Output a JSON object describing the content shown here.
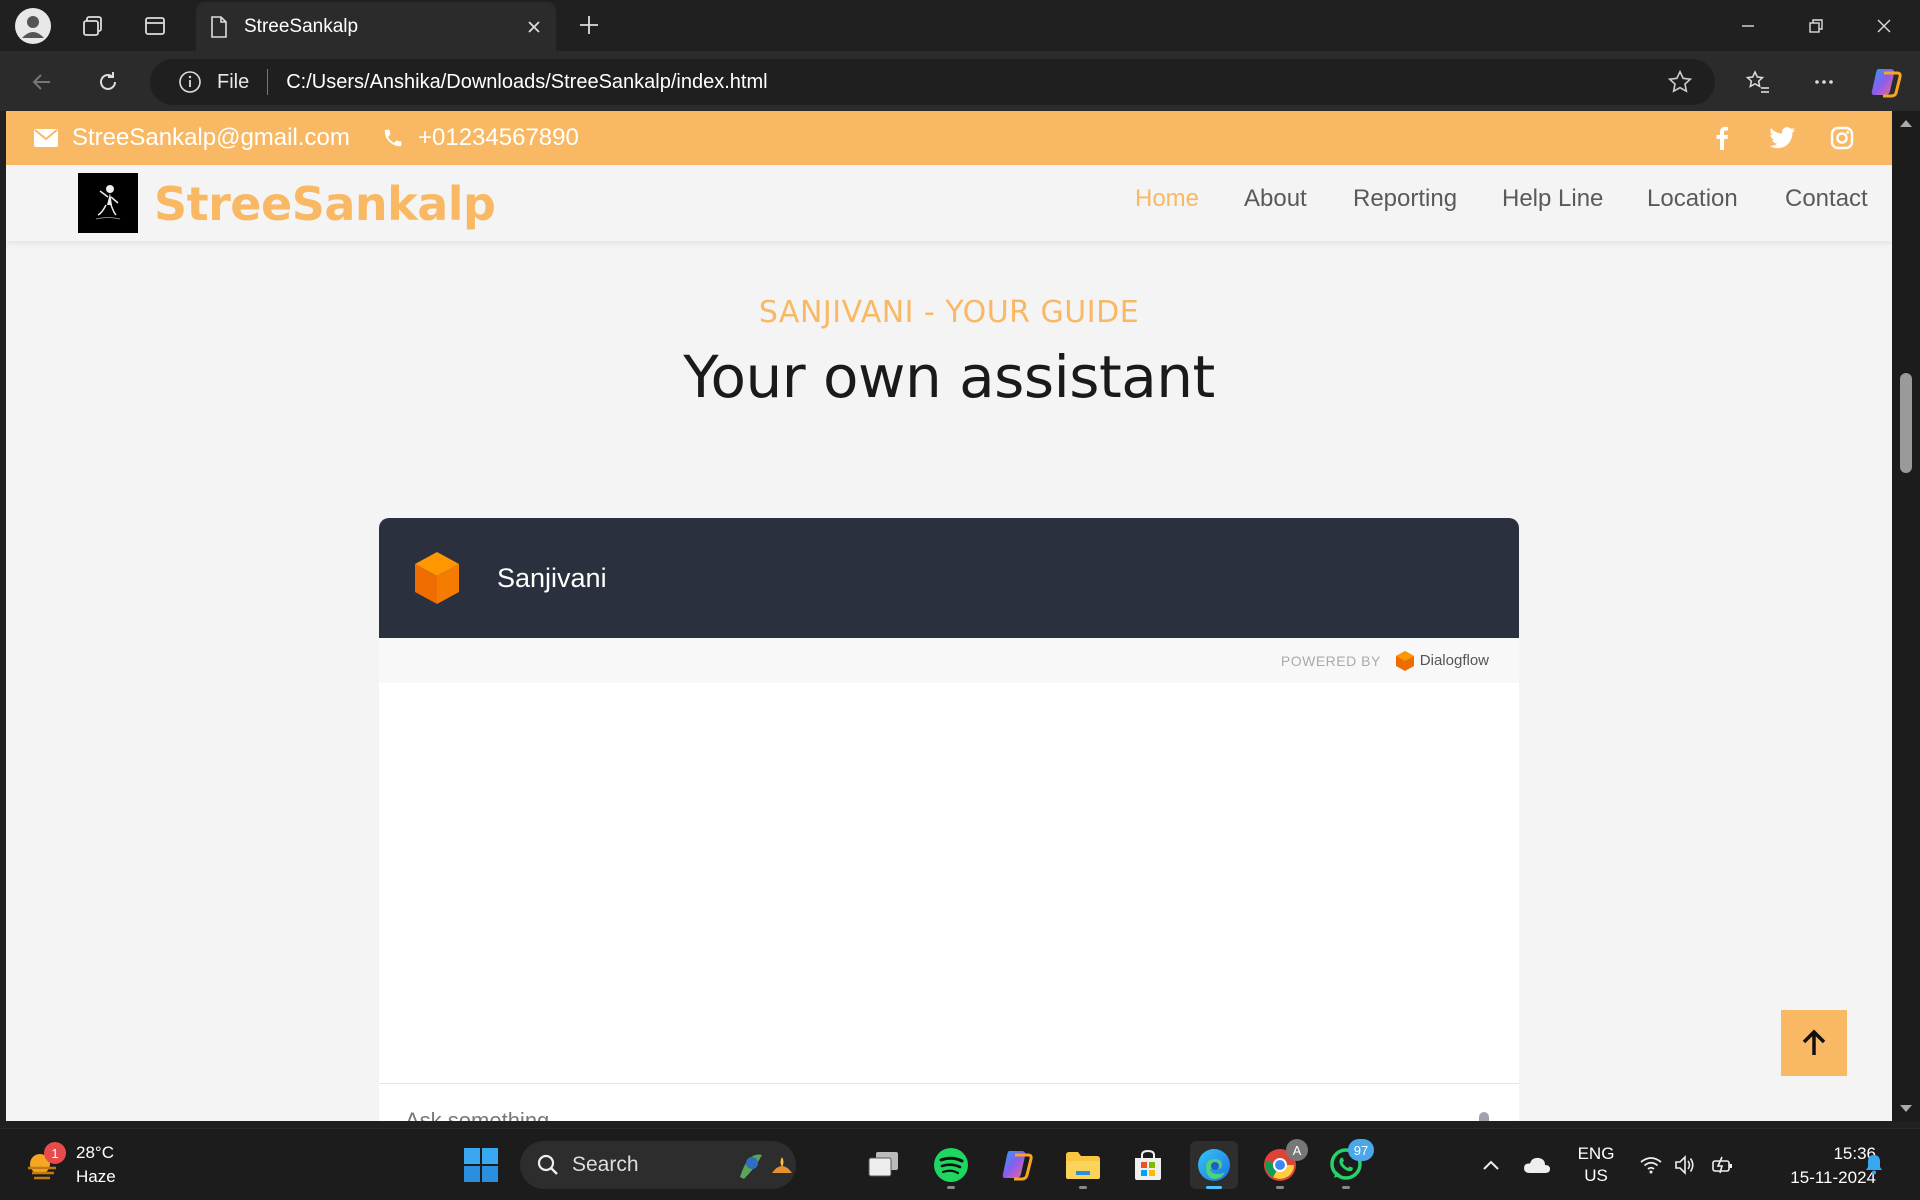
{
  "browser": {
    "tab_title": "StreeSankalp",
    "address_prefix": "File",
    "url": "C:/Users/Anshika/Downloads/StreeSankalp/index.html"
  },
  "site": {
    "email": "StreeSankalp@gmail.com",
    "phone": "+01234567890",
    "brand": "StreeSankalp",
    "accent_color": "#f9b964",
    "nav": [
      {
        "label": "Home",
        "active": true
      },
      {
        "label": "About",
        "active": false
      },
      {
        "label": "Reporting",
        "active": false
      },
      {
        "label": "Help Line",
        "active": false
      },
      {
        "label": "Location",
        "active": false
      },
      {
        "label": "Contact",
        "active": false
      }
    ],
    "social_icons": [
      "facebook-icon",
      "twitter-icon",
      "instagram-icon"
    ]
  },
  "section": {
    "subtitle": "SANJIVANI - YOUR GUIDE",
    "title": "Your own assistant"
  },
  "chatbot": {
    "name": "Sanjivani",
    "powered_by": "POWERED BY",
    "provider": "Dialogflow",
    "input_placeholder": "Ask something..."
  },
  "taskbar": {
    "weather_temp": "28°C",
    "weather_desc": "Haze",
    "weather_badge": "1",
    "search_label": "Search",
    "whatsapp_badge": "97",
    "lang_line1": "ENG",
    "lang_line2": "US",
    "time": "15:36",
    "date": "15-11-2024"
  }
}
